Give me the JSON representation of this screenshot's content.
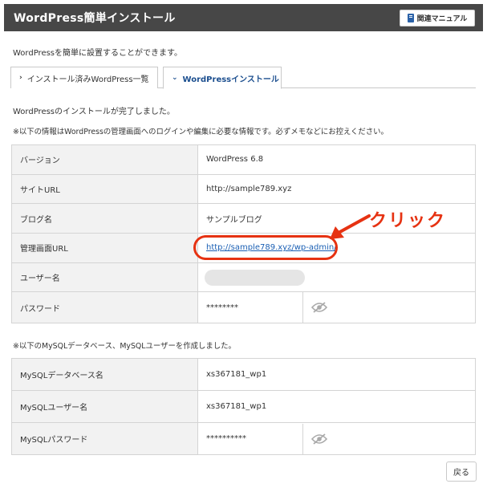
{
  "header": {
    "title": "WordPress簡単インストール",
    "manual_label": "関連マニュアル"
  },
  "intro": "WordPressを簡単に設置することができます。",
  "tabs": [
    {
      "label": "インストール済みWordPress一覧",
      "active": false
    },
    {
      "label": "WordPressインストール",
      "active": true
    }
  ],
  "complete_message": "WordPressのインストールが完了しました。",
  "info_note": "※以下の情報はWordPressの管理画面へのログインや編集に必要な情報です。必ずメモなどにお控えください。",
  "info_rows": [
    {
      "label": "バージョン",
      "value": "WordPress 6.8"
    },
    {
      "label": "サイトURL",
      "value": "http://sample789.xyz"
    },
    {
      "label": "ブログ名",
      "value": "サンプルブログ"
    },
    {
      "label": "管理画面URL",
      "value": "http://sample789.xyz/wp-admin/"
    },
    {
      "label": "ユーザー名",
      "value": ""
    },
    {
      "label": "パスワード",
      "value": "********"
    }
  ],
  "mysql_note": "※以下のMySQLデータベース、MySQLユーザーを作成しました。",
  "mysql_rows": [
    {
      "label": "MySQLデータベース名",
      "value": "xs367181_wp1"
    },
    {
      "label": "MySQLユーザー名",
      "value": "xs367181_wp1"
    },
    {
      "label": "MySQLパスワード",
      "value": "**********"
    }
  ],
  "annotation": {
    "text": "クリック",
    "color": "#e63212"
  },
  "back_label": "戻る",
  "icons": {
    "manual": "book-icon",
    "password_toggle": "eye-slash-icon",
    "tab": "chevron-icon"
  }
}
